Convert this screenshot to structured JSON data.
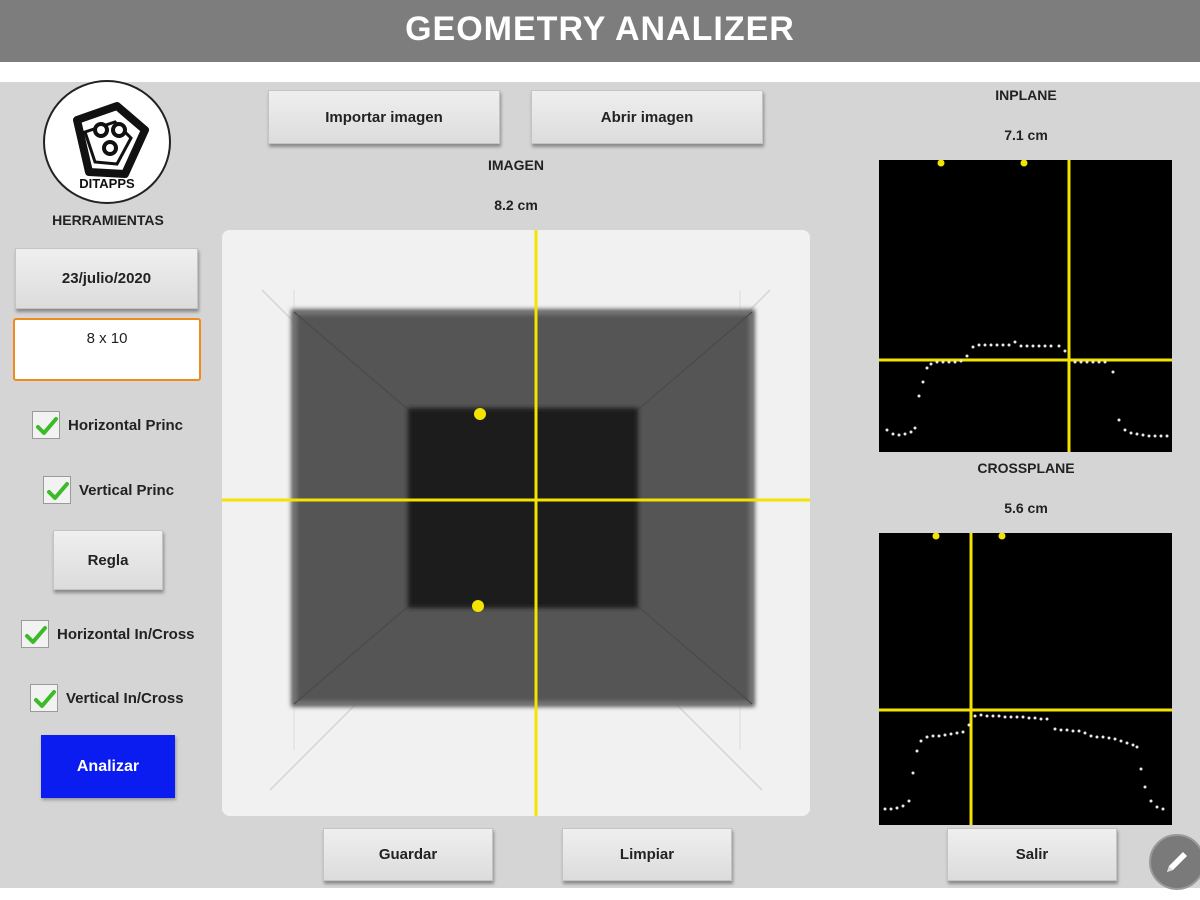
{
  "app": {
    "title": "GEOMETRY ANALIZER"
  },
  "left": {
    "logo_text": "DITAPPS",
    "section_label": "HERRAMIENTAS",
    "date_button": "23/julio/2020",
    "size_input": "8 x 10",
    "checkboxes": [
      {
        "label": "Horizontal Princ",
        "checked": true
      },
      {
        "label": "Vertical Princ",
        "checked": true
      },
      {
        "label": "Horizontal In/Cross",
        "checked": true
      },
      {
        "label": "Vertical In/Cross",
        "checked": true
      }
    ],
    "regla_button": "Regla",
    "analizar_button": "Analizar"
  },
  "center": {
    "import_button": "Importar imagen",
    "open_button": "Abrir imagen",
    "image_label": "IMAGEN",
    "image_measure": "8.2 cm",
    "save_button": "Guardar",
    "clear_button": "Limpiar"
  },
  "right": {
    "inplane_label": "INPLANE",
    "inplane_measure": "7.1 cm",
    "crossplane_label": "CROSSPLANE",
    "crossplane_measure": "5.6 cm",
    "exit_button": "Salir"
  },
  "colors": {
    "accent_yellow": "#f2e400",
    "analizar_blue": "#0a1cf0",
    "input_border": "#f08a1c",
    "titlebar": "#7d7d7d"
  },
  "icons": [
    "ditapps-logo-icon",
    "checkmark-icon",
    "pencil-icon"
  ]
}
